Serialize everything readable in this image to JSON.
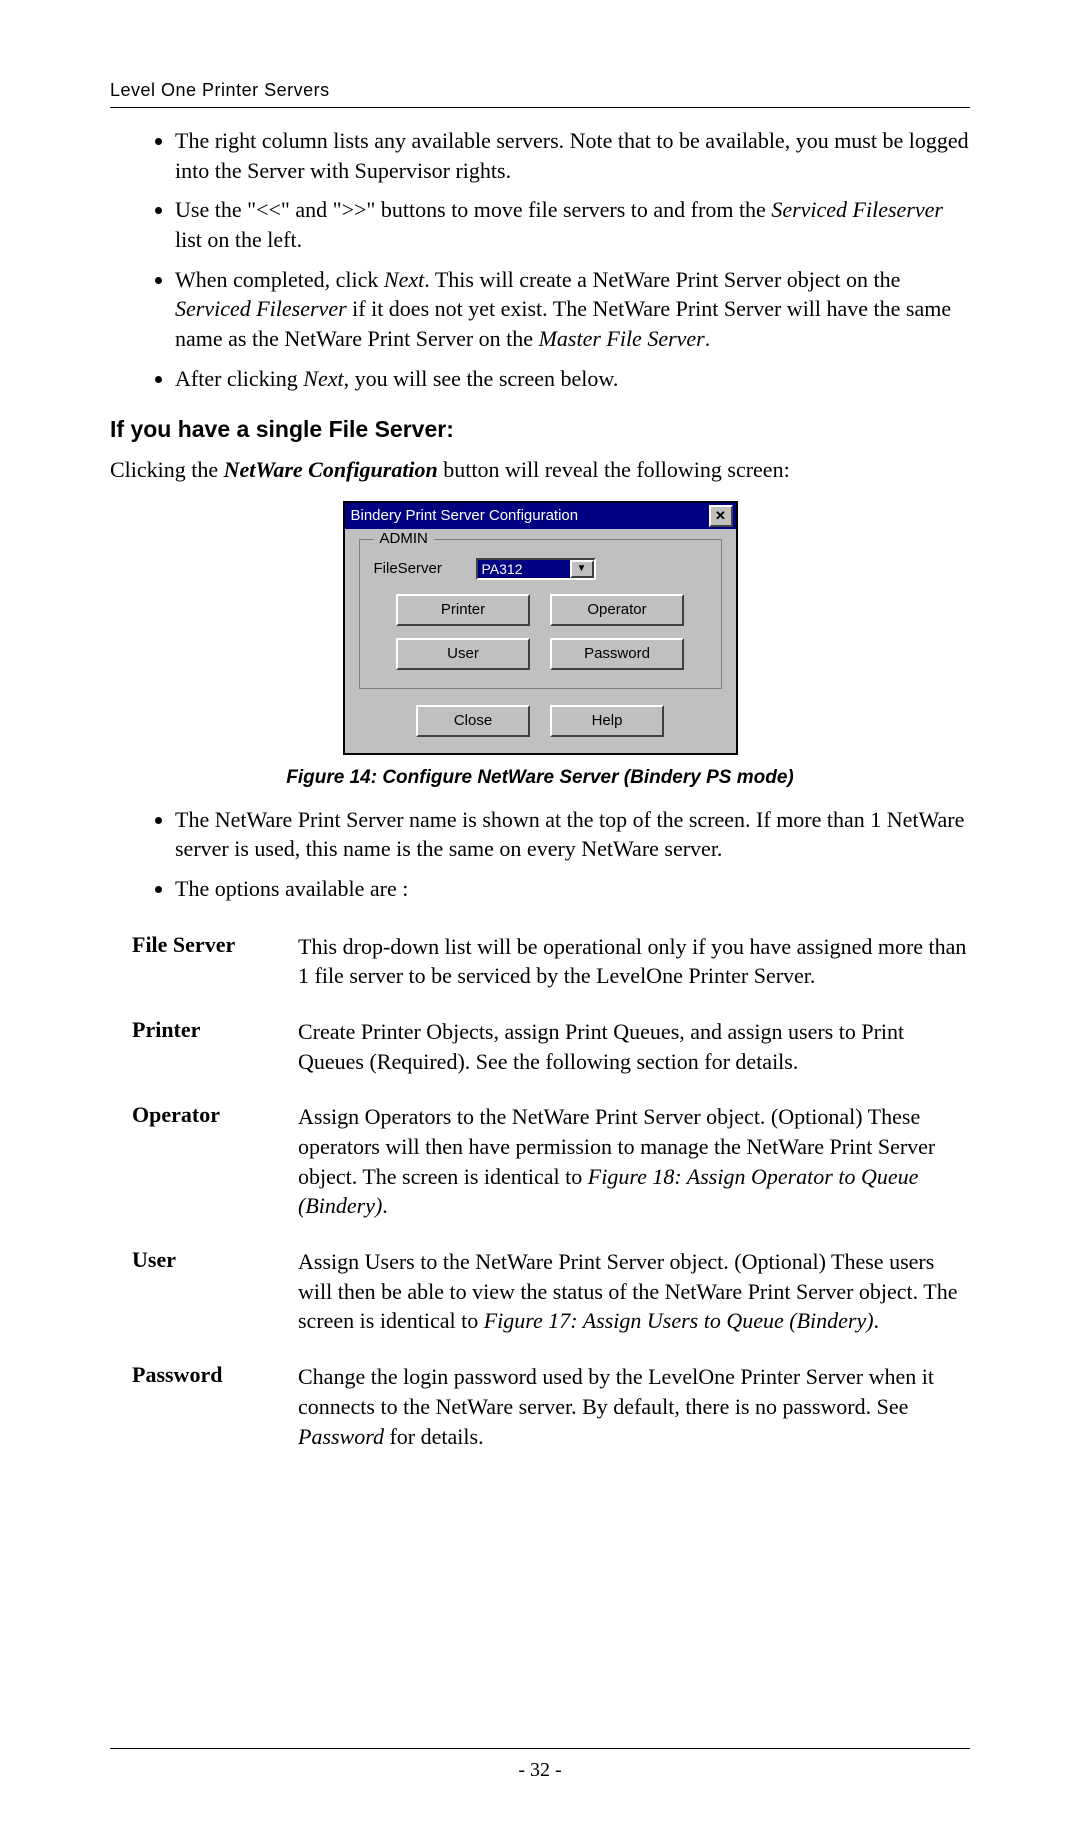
{
  "header": {
    "title": "Level One Printer Servers"
  },
  "bullets_top": [
    {
      "runs": [
        {
          "t": "The right column lists any available servers. Note that to be available, you must be logged into the Server with Supervisor rights."
        }
      ]
    },
    {
      "runs": [
        {
          "t": "Use the \"<<\" and \">>\" buttons to move file servers to and from the "
        },
        {
          "t": "Serviced Fileserver",
          "style": "italic"
        },
        {
          "t": " list on the left."
        }
      ]
    },
    {
      "runs": [
        {
          "t": "When completed, click "
        },
        {
          "t": "Next",
          "style": "italic"
        },
        {
          "t": ". This will create a NetWare Print Server object on the "
        },
        {
          "t": "Serviced Fileserver",
          "style": "italic"
        },
        {
          "t": " if it does not yet exist. The NetWare Print Server will have the same name as the NetWare Print Server on the "
        },
        {
          "t": "Master File Server",
          "style": "italic"
        },
        {
          "t": "."
        }
      ]
    },
    {
      "runs": [
        {
          "t": "After clicking "
        },
        {
          "t": "Next",
          "style": "italic"
        },
        {
          "t": ", you will see the screen below."
        }
      ]
    }
  ],
  "section_heading": "If you have a single File Server:",
  "intro_para": {
    "runs": [
      {
        "t": "Clicking the "
      },
      {
        "t": "NetWare Configuration",
        "style": "bold-italic"
      },
      {
        "t": " button will reveal the following screen:"
      }
    ]
  },
  "dialog": {
    "title": "Bindery Print Server Configuration",
    "close_glyph": "✕",
    "legend": "ADMIN",
    "fileserver_label": "FileServer",
    "fileserver_value": "PA312",
    "buttons_row1": {
      "a": "Printer",
      "b": "Operator"
    },
    "buttons_row2": {
      "a": "User",
      "b": "Password"
    },
    "buttons_bottom": {
      "a": "Close",
      "b": "Help"
    }
  },
  "figure_caption": "Figure 14: Configure NetWare Server (Bindery PS mode)",
  "bullets_mid": [
    {
      "runs": [
        {
          "t": "The NetWare Print Server name is shown at the top of the screen. If more than 1 NetWare server is used, this name is the same on every NetWare server."
        }
      ]
    },
    {
      "runs": [
        {
          "t": "The options available are :"
        }
      ]
    }
  ],
  "defs": [
    {
      "term": "File Server",
      "runs": [
        {
          "t": "This drop-down list will be operational only if you have assigned more than 1 file server to be serviced by the LevelOne Printer Server."
        }
      ]
    },
    {
      "term": "Printer",
      "runs": [
        {
          "t": "Create Printer Objects, assign Print Queues, and assign users to Print Queues (Required). See the following section for details."
        }
      ]
    },
    {
      "term": "Operator",
      "runs": [
        {
          "t": "Assign Operators to the NetWare Print Server object. (Optional) These operators will then have permission to manage the NetWare Print Server object. The screen is identical to "
        },
        {
          "t": "Figure 18: Assign Operator to Queue (Bindery)",
          "style": "italic"
        },
        {
          "t": "."
        }
      ]
    },
    {
      "term": "User",
      "runs": [
        {
          "t": "Assign Users to the NetWare Print Server object. (Optional) These users will then be able to view the status of the NetWare Print Server object. The screen is identical to "
        },
        {
          "t": "Figure 17: Assign Users to Queue (Bindery)",
          "style": "italic"
        },
        {
          "t": "."
        }
      ]
    },
    {
      "term": "Password",
      "runs": [
        {
          "t": "Change the login password used by the LevelOne Printer Server when it connects to the NetWare server. By default, there is no password. See "
        },
        {
          "t": "Password",
          "style": "italic"
        },
        {
          "t": " for details."
        }
      ]
    }
  ],
  "footer": {
    "page_prefix": "- ",
    "page_num": "32",
    "page_suffix": " -"
  }
}
